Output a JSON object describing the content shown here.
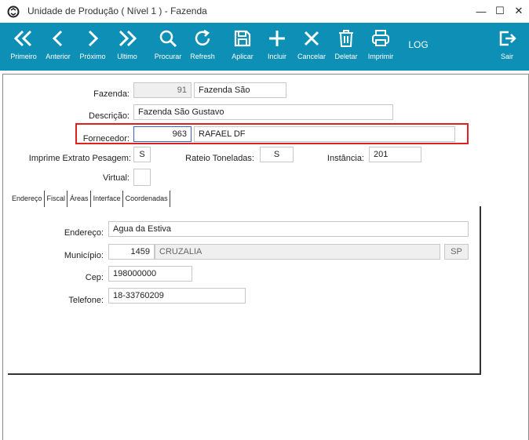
{
  "window": {
    "title": "Unidade de Produção ( Nível 1 ) - Fazenda",
    "minimize": "—",
    "maximize": "☐",
    "close": "✕"
  },
  "toolbar": {
    "first": "Primeiro",
    "previous": "Anterior",
    "next": "Próximo",
    "last": "Ultimo",
    "search": "Procurar",
    "refresh": "Refresh",
    "apply": "Aplicar",
    "insert": "Incluir",
    "cancel": "Cancelar",
    "delete": "Deletar",
    "print": "Imprimir",
    "log": "LOG",
    "exit": "Sair"
  },
  "form": {
    "fazenda_label": "Fazenda:",
    "fazenda_code": "91",
    "fazenda_name": "Fazenda São",
    "descricao_label": "Descrição:",
    "descricao_value": "Fazenda São Gustavo",
    "fornecedor_label": "Fornecedor:",
    "fornecedor_code": "963",
    "fornecedor_name": "RAFAEL DF",
    "extrato_label": "Imprime Extrato Pesagem:",
    "extrato_value": "S",
    "rateio_label": "Rateio Toneladas:",
    "rateio_value": "S",
    "instancia_label": "Instância:",
    "instancia_value": "201",
    "virtual_label": "Virtual:",
    "virtual_value": ""
  },
  "tabs": [
    "Endereço",
    "Fiscal",
    "Áreas",
    "Interface",
    "Coordenadas"
  ],
  "address": {
    "endereco_label": "Endereço:",
    "endereco_value": "Agua da Estiva",
    "municipio_label": "Município:",
    "municipio_code": "1459",
    "municipio_name": "CRUZALIA",
    "uf": "SP",
    "cep_label": "Cep:",
    "cep_value": "198000000",
    "telefone_label": "Telefone:",
    "telefone_value": "18-33760209"
  },
  "colors": {
    "toolbar_bg": "#0e8fb5",
    "highlight_border": "#e0201a"
  }
}
